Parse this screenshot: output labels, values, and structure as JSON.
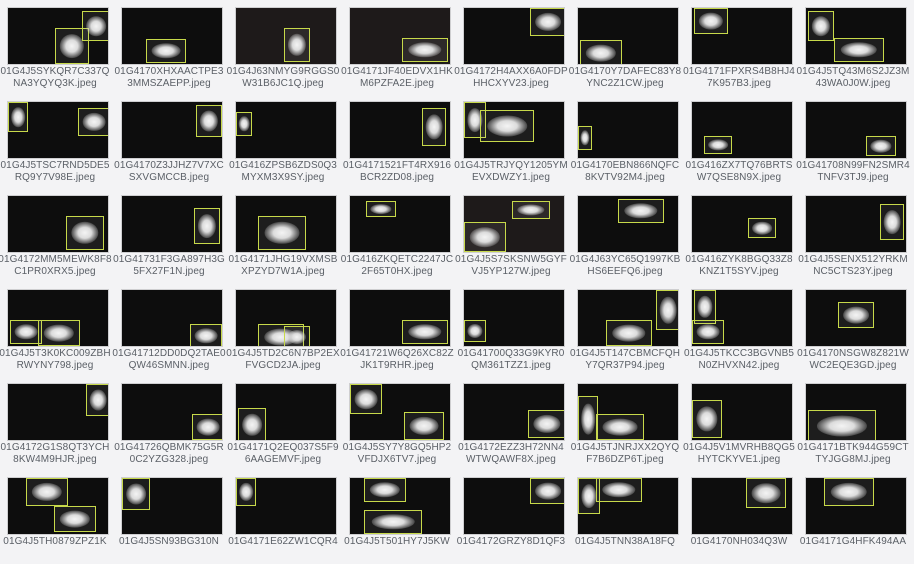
{
  "tiles": [
    {
      "name": "01G4J5SYKQR7C337QNA3YQYQ3K.jpeg"
    },
    {
      "name": "01G4170XHXAACTPE33MMSZAEPP.jpeg"
    },
    {
      "name": "01G4J63NMYG9RGGS0W31B6JC1Q.jpeg"
    },
    {
      "name": "01G4171JF40EDVX1HKM6PZFA2E.jpeg"
    },
    {
      "name": "01G4172H4AXX6A0FDPHHCXYV23.jpeg"
    },
    {
      "name": "01G4170Y7DAFEC83Y8YNC2Z1CW.jpeg"
    },
    {
      "name": "01G4171FPXRS4B8HJ47K957B3.jpeg"
    },
    {
      "name": "01G4J5TQ43M6S2JZ3M43WA0J0W.jpeg"
    },
    {
      "name": "01G4J5TSC7RND5DE5RQ9Y7V98E.jpeg"
    },
    {
      "name": "01G4170Z3JJHZ7V7XCSXVGMCCB.jpeg"
    },
    {
      "name": "01G416ZPSB6ZDS0Q3MYXM3X9SY.jpeg"
    },
    {
      "name": "01G4171521FT4RX916BCR2ZD08.jpeg"
    },
    {
      "name": "01G4J5TRJYQY1205YMEVXDWZY1.jpeg"
    },
    {
      "name": "01G4170EBN866NQFC8KVTV92M4.jpeg"
    },
    {
      "name": "01G416ZX7TQ76BRTSW7QSE8N9X.jpeg"
    },
    {
      "name": "01G41708N99FN2SMR4TNFV3TJ9.jpeg"
    },
    {
      "name": "01G4172MM5MEWK8F8C1PR0XRX5.jpeg"
    },
    {
      "name": "01G41731F3GA897H3G5FX27F1N.jpeg"
    },
    {
      "name": "01G4171JHG19VXMSBXPZYD7W1A.jpeg"
    },
    {
      "name": "01G416ZKQETC2247JC2F65T0HX.jpeg"
    },
    {
      "name": "01G4J5S7SKSNW5GYFVJ5YP127W.jpeg"
    },
    {
      "name": "01G4J63YC65Q1997KBHS6EEFQ6.jpeg"
    },
    {
      "name": "01G416ZYK8BGQ33Z8KNZ1T5SYV.jpeg"
    },
    {
      "name": "01G4J5SENX512YRKMNC5CTS23Y.jpeg"
    },
    {
      "name": "01G4J5T3K0KC009ZBHRWYNY798.jpeg"
    },
    {
      "name": "01G41712DD0DQ2TAE0QW46SMNN.jpeg"
    },
    {
      "name": "01G4J5TD2C6N7BP2EXFVGCD2JA.jpeg"
    },
    {
      "name": "01G41721W6Q26XC82ZJK1T9RHR.jpeg"
    },
    {
      "name": "01G41700Q33G9KYR0QM361TZZ1.jpeg"
    },
    {
      "name": "01G4J5T147CBMCFQHY7QR37P94.jpeg"
    },
    {
      "name": "01G4J5TKCC3BGVNB5N0ZHVXN42.jpeg"
    },
    {
      "name": "01G4170NSGW8Z821WWC2EQE3GD.jpeg"
    },
    {
      "name": "01G4172G1S8QT3YCH8KW4M9HJR.jpeg"
    },
    {
      "name": "01G41726QBMK75G5R0C2YZG328.jpeg"
    },
    {
      "name": "01G4171Q2EQ037S5F96AAGEMVF.jpeg"
    },
    {
      "name": "01G4J5SY7Y8GQ5HP2VFDJX6TV7.jpeg"
    },
    {
      "name": "01G4172EZZ3H72NN4WTWQAWF8X.jpeg"
    },
    {
      "name": "01G4J5TJNRJXX2QYQF7B6DZP6T.jpeg"
    },
    {
      "name": "01G4J5V1MVRHB8QG5HYTCKYVE1.jpeg"
    },
    {
      "name": "01G4171BTK944G59CTTYJGG8MJ.jpeg"
    },
    {
      "name": "01G4J5TH0879ZPZ1K"
    },
    {
      "name": "01G4J5SN93BG310N"
    },
    {
      "name": "01G4171E62ZW1CQR4"
    },
    {
      "name": "01G4J5T501HY7J5KW"
    },
    {
      "name": "01G4172GRZY8D1QF3"
    },
    {
      "name": "01G4J5TNN38A18FQ"
    },
    {
      "name": "01G4170NH034Q3W"
    },
    {
      "name": "01G4171G4HFK494AA"
    }
  ]
}
